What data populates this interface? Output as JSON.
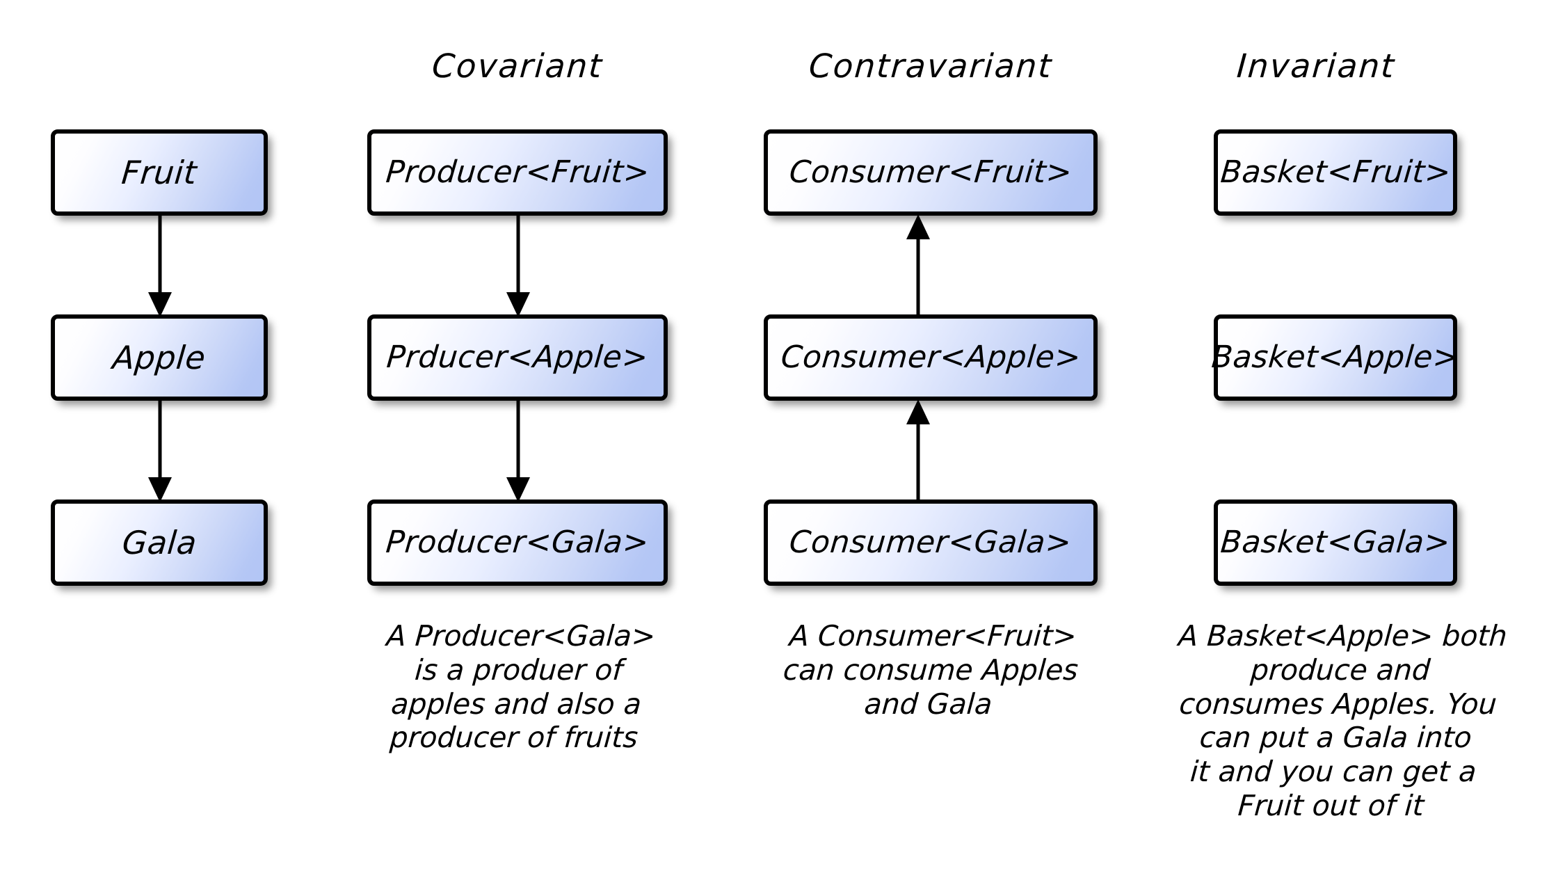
{
  "page": {
    "title": "Generics Variance Diagram",
    "background_color": "#ffffff",
    "box_fill_start": "#ffffff",
    "box_fill_end": "#b5c7f5",
    "box_border_color": "#000000",
    "text_color": "#000000"
  },
  "columns": [
    {
      "id": "hierarchy",
      "header": "",
      "arrow_direction": "down",
      "nodes": [
        {
          "label": "Fruit"
        },
        {
          "label": "Apple"
        },
        {
          "label": "Gala"
        }
      ],
      "caption": {
        "lines": []
      }
    },
    {
      "id": "covariant",
      "header": "Covariant",
      "arrow_direction": "down",
      "nodes": [
        {
          "label": "Producer<Fruit>"
        },
        {
          "label": "Prducer<Apple>"
        },
        {
          "label": "Producer<Gala>"
        }
      ],
      "caption": {
        "lines": [
          "A Producer<Gala>",
          "is a produer of",
          "apples and also a",
          "producer of fruits"
        ]
      }
    },
    {
      "id": "contravariant",
      "header": "Contravariant",
      "arrow_direction": "up",
      "nodes": [
        {
          "label": "Consumer<Fruit>"
        },
        {
          "label": "Consumer<Apple>"
        },
        {
          "label": "Consumer<Gala>"
        }
      ],
      "caption": {
        "lines": [
          "A Consumer<Fruit>",
          "can consume Apples",
          "and Gala"
        ]
      }
    },
    {
      "id": "invariant",
      "header": "Invariant",
      "arrow_direction": "none",
      "nodes": [
        {
          "label": "Basket<Fruit>"
        },
        {
          "label": "Basket<Apple>"
        },
        {
          "label": "Basket<Gala>"
        }
      ],
      "caption": {
        "lines": [
          "A Basket<Apple> both",
          "produce and",
          "consumes Apples. You",
          "can put a Gala into",
          "it and you can get a",
          "Fruit out of it"
        ]
      }
    }
  ]
}
